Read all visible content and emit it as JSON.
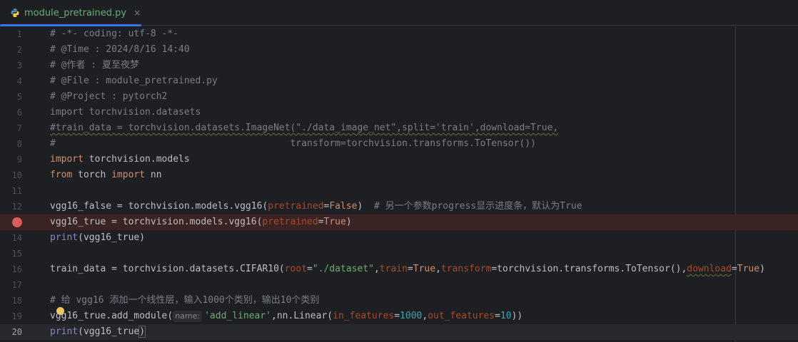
{
  "tab": {
    "filename": "module_pretrained.py",
    "close_glyph": "×",
    "icon": "python-file-icon"
  },
  "editor": {
    "line_numbers": [
      "1",
      "2",
      "3",
      "4",
      "5",
      "6",
      "7",
      "8",
      "9",
      "10",
      "11",
      "12",
      "13",
      "14",
      "15",
      "16",
      "17",
      "18",
      "19",
      "20"
    ],
    "breakpoint_line": 13,
    "current_line": 20,
    "code": {
      "l1": "# -*- coding: utf-8 -*-",
      "l2": "# @Time : 2024/8/16 14:40",
      "l3": "# @作者 : 夏至夜梦",
      "l4": "# @File : module_pretrained.py",
      "l5": "# @Project : pytorch2",
      "l6": "import torchvision.datasets",
      "l7": "#train_data = torchvision.datasets.ImageNet(\"./data_image_net\",split='train',download=True,",
      "l8": "#                                          transform=torchvision.transforms.ToTensor())",
      "l9_kw": "import",
      "l9_rest": " torchvision.models",
      "l10_kw1": "from",
      "l10_mid": " torch ",
      "l10_kw2": "import",
      "l10_rest": " nn",
      "l12_a": "vgg16_false = torchvision.models.vgg16(",
      "l12_p": "pretrained",
      "l12_eq": "=",
      "l12_v": "False",
      "l12_b": ")  ",
      "l12_c": "# 另一个参数progress显示进度条，默认为True",
      "l13_a": "vgg16_true = torchvision.models.vgg16(",
      "l13_p": "pretrained",
      "l13_eq": "=",
      "l13_v": "True",
      "l13_b": ")",
      "l14_fn": "print",
      "l14_rest": "(vgg16_true)",
      "l16_a": "train_data = torchvision.datasets.CIFAR10(",
      "l16_p1": "root",
      "l16_eq1": "=",
      "l16_s1": "\"./dataset\"",
      "l16_c1": ",",
      "l16_p2": "train",
      "l16_eq2": "=",
      "l16_v2": "True",
      "l16_c2": ",",
      "l16_p3": "transform",
      "l16_eq3": "=torchvision.transforms.ToTensor()",
      "l16_c3": ",",
      "l16_p4": "download",
      "l16_eq4": "=",
      "l16_v4": "True",
      "l16_b": ")",
      "l18": "# 给 vgg16 添加一个线性层，输入1000个类别，输出10个类别",
      "l19_a": "vgg16_true.add_module(",
      "l19_hint": "name:",
      "l19_s": "'add_linear'",
      "l19_c1": ",",
      "l19_b": "nn.Linear(",
      "l19_p1": "in_features",
      "l19_eq1": "=",
      "l19_n1": "1000",
      "l19_c2": ",",
      "l19_p2": "out_features",
      "l19_eq2": "=",
      "l19_n2": "10",
      "l19_e": "))",
      "l20_fn": "print",
      "l20_a": "(vgg16_true",
      "l20_b": ")"
    }
  },
  "colors": {
    "background": "#1e1f22",
    "comment": "#7a7e85",
    "keyword": "#cf8e6d",
    "string": "#6aab73",
    "number": "#2aacb8",
    "param": "#aa4926",
    "breakpoint": "#db5c5c",
    "tab_accent": "#3574f0"
  }
}
